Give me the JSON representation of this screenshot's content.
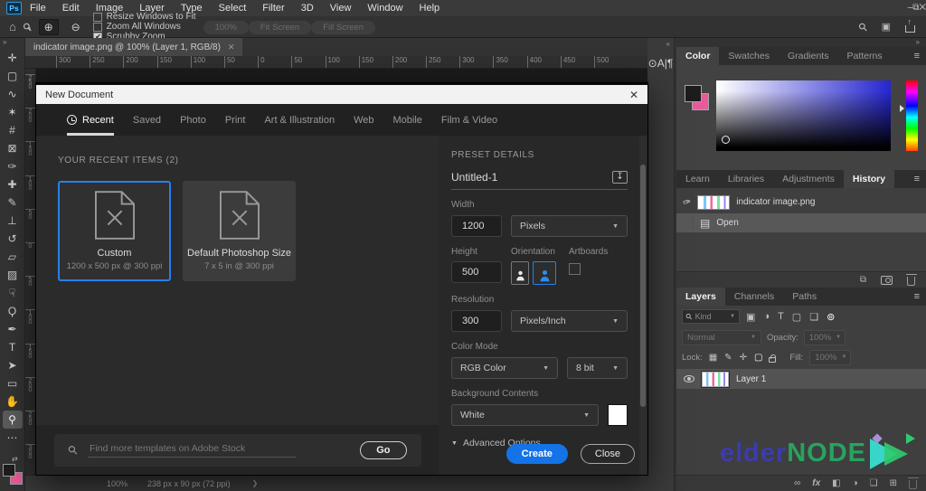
{
  "colors": {
    "accent_blue": "#1473e6",
    "selection_blue": "#2680eb",
    "bg_swatch_pink": "#e85a9b",
    "watermark_blue": "#3c3caa",
    "watermark_green": "#27a35f"
  },
  "menubar": {
    "logo": "Ps",
    "items": [
      "File",
      "Edit",
      "Image",
      "Layer",
      "Type",
      "Select",
      "Filter",
      "3D",
      "View",
      "Window",
      "Help"
    ],
    "window_controls": [
      {
        "name": "minimize-button",
        "glyph": "–"
      },
      {
        "name": "restore-button",
        "glyph": "⧉"
      },
      {
        "name": "close-button",
        "glyph": "✕"
      }
    ]
  },
  "optionsbar": {
    "checkboxes": [
      {
        "label": "Resize Windows to Fit",
        "checked": false
      },
      {
        "label": "Zoom All Windows",
        "checked": false
      },
      {
        "label": "Scrubby Zoom",
        "checked": true
      }
    ],
    "buttons": [
      {
        "label": "100%"
      },
      {
        "label": "Fit Screen"
      },
      {
        "label": "Fill Screen"
      }
    ]
  },
  "toolbar": {
    "collapse": "»",
    "tools": [
      {
        "name": "move-tool",
        "glyph": "✛"
      },
      {
        "name": "rectangular-marquee-tool",
        "glyph": "▢"
      },
      {
        "name": "lasso-tool",
        "glyph": "∿"
      },
      {
        "name": "object-selection-tool",
        "glyph": "✶"
      },
      {
        "name": "crop-tool",
        "glyph": "#"
      },
      {
        "name": "frame-tool",
        "glyph": "⊠"
      },
      {
        "name": "eyedropper-tool",
        "glyph": "✑"
      },
      {
        "name": "healing-brush-tool",
        "glyph": "✚"
      },
      {
        "name": "brush-tool",
        "glyph": "✎"
      },
      {
        "name": "clone-stamp-tool",
        "glyph": "⊥"
      },
      {
        "name": "history-brush-tool",
        "glyph": "↺"
      },
      {
        "name": "eraser-tool",
        "glyph": "▱"
      },
      {
        "name": "gradient-tool",
        "glyph": "▨"
      },
      {
        "name": "smudge-tool",
        "glyph": "☟"
      },
      {
        "name": "dodge-tool",
        "glyph": "Ϙ"
      },
      {
        "name": "pen-tool",
        "glyph": "✒"
      },
      {
        "name": "type-tool",
        "glyph": "T"
      },
      {
        "name": "path-selection-tool",
        "glyph": "➤"
      },
      {
        "name": "rectangle-tool",
        "glyph": "▭"
      },
      {
        "name": "hand-tool",
        "glyph": "✋"
      },
      {
        "name": "zoom-tool",
        "glyph": "⚲",
        "active": true
      },
      {
        "name": "edit-toolbar",
        "glyph": "⋯"
      }
    ]
  },
  "document": {
    "tab_title": "indicator image.png @ 100% (Layer 1, RGB/8)",
    "tab_close": "✕",
    "ruler_h": [
      "300",
      "250",
      "200",
      "150",
      "100",
      "50",
      "0",
      "50",
      "100",
      "150",
      "200",
      "250",
      "300",
      "350",
      "400",
      "450",
      "500"
    ],
    "ruler_v": [
      "250",
      "200",
      "150",
      "100",
      "50",
      "0",
      "50",
      "100",
      "150",
      "200",
      "250",
      "300"
    ]
  },
  "dialog": {
    "title": "New Document",
    "close": "✕",
    "tabs": [
      {
        "label": "Recent",
        "active": true
      },
      {
        "label": "Saved"
      },
      {
        "label": "Photo"
      },
      {
        "label": "Print"
      },
      {
        "label": "Art & Illustration"
      },
      {
        "label": "Web"
      },
      {
        "label": "Mobile"
      },
      {
        "label": "Film & Video"
      }
    ],
    "recent_heading": "YOUR RECENT ITEMS  (2)",
    "cards": [
      {
        "title": "Custom",
        "subtitle": "1200 x 500 px @ 300 ppi",
        "selected": true
      },
      {
        "title": "Default Photoshop Size",
        "subtitle": "7 x 5 in @ 300 ppi",
        "selected": false
      }
    ],
    "stock": {
      "placeholder": "Find more templates on Adobe Stock",
      "go": "Go"
    },
    "preset": {
      "heading": "PRESET DETAILS",
      "doc_name": "Untitled-1",
      "save_icon": "↧",
      "width_label": "Width",
      "width_value": "1200",
      "width_unit": "Pixels",
      "height_label": "Height",
      "height_value": "500",
      "orientation_label": "Orientation",
      "artboards_label": "Artboards",
      "resolution_label": "Resolution",
      "resolution_value": "300",
      "resolution_unit": "Pixels/Inch",
      "color_mode_label": "Color Mode",
      "color_mode_value": "RGB Color",
      "bit_depth_value": "8 bit",
      "background_label": "Background Contents",
      "background_value": "White",
      "advanced_label": "Advanced Options",
      "create": "Create",
      "close_btn": "Close"
    }
  },
  "dock": {
    "collapse_left": "«",
    "collapse_right": "»",
    "menu_icon": "≡",
    "side_icons": [
      {
        "name": "properties-panel-icon",
        "glyph": "⊙"
      },
      {
        "name": "character-panel-icon",
        "glyph": "A|"
      },
      {
        "name": "paragraph-panel-icon",
        "glyph": "¶"
      }
    ],
    "color_panel": {
      "tabs": [
        {
          "label": "Color",
          "active": true
        },
        {
          "label": "Swatches"
        },
        {
          "label": "Gradients"
        },
        {
          "label": "Patterns"
        }
      ]
    },
    "history_panel": {
      "tabs": [
        {
          "label": "Learn"
        },
        {
          "label": "Libraries"
        },
        {
          "label": "Adjustments"
        },
        {
          "label": "History",
          "active": true
        }
      ],
      "snapshot_name": "indicator image.png",
      "step_name": "Open",
      "doc_icon": "▤",
      "new_doc_icon": "⧉"
    },
    "layers_panel": {
      "tabs": [
        {
          "label": "Layers",
          "active": true
        },
        {
          "label": "Channels"
        },
        {
          "label": "Paths"
        }
      ],
      "search_label": "Kind",
      "filter_icons": [
        {
          "name": "filter-image-icon",
          "glyph": "▣"
        },
        {
          "name": "filter-adjustment-icon",
          "glyph": "◑"
        },
        {
          "name": "filter-type-icon",
          "glyph": "T"
        },
        {
          "name": "filter-shape-icon",
          "glyph": "▢"
        },
        {
          "name": "filter-smart-object-icon",
          "glyph": "❏"
        },
        {
          "name": "filter-pin-icon",
          "glyph": "⊚"
        }
      ],
      "blend_mode": "Normal",
      "opacity_label": "Opacity:",
      "opacity_value": "100%",
      "lock_label": "Lock:",
      "lock_icons": [
        {
          "name": "lock-transparency-icon",
          "glyph": "▦"
        },
        {
          "name": "lock-paint-icon",
          "glyph": "✎"
        },
        {
          "name": "lock-move-icon",
          "glyph": "✛"
        },
        {
          "name": "lock-artboard-icon",
          "glyph": "▢"
        }
      ],
      "fill_label": "Fill:",
      "fill_value": "100%",
      "layer_name": "Layer 1",
      "foot_icons": {
        "link": "∞",
        "fx": "fx",
        "mask": "◧",
        "adjustment": "◑",
        "group": "❏",
        "new_layer": "⊞"
      }
    }
  },
  "statusbar": {
    "zoom": "100%",
    "doc_info": "238 px x 90 px (72 ppi)",
    "chevron": "❯"
  },
  "watermark": {
    "part1": "elder",
    "part2": "node"
  }
}
